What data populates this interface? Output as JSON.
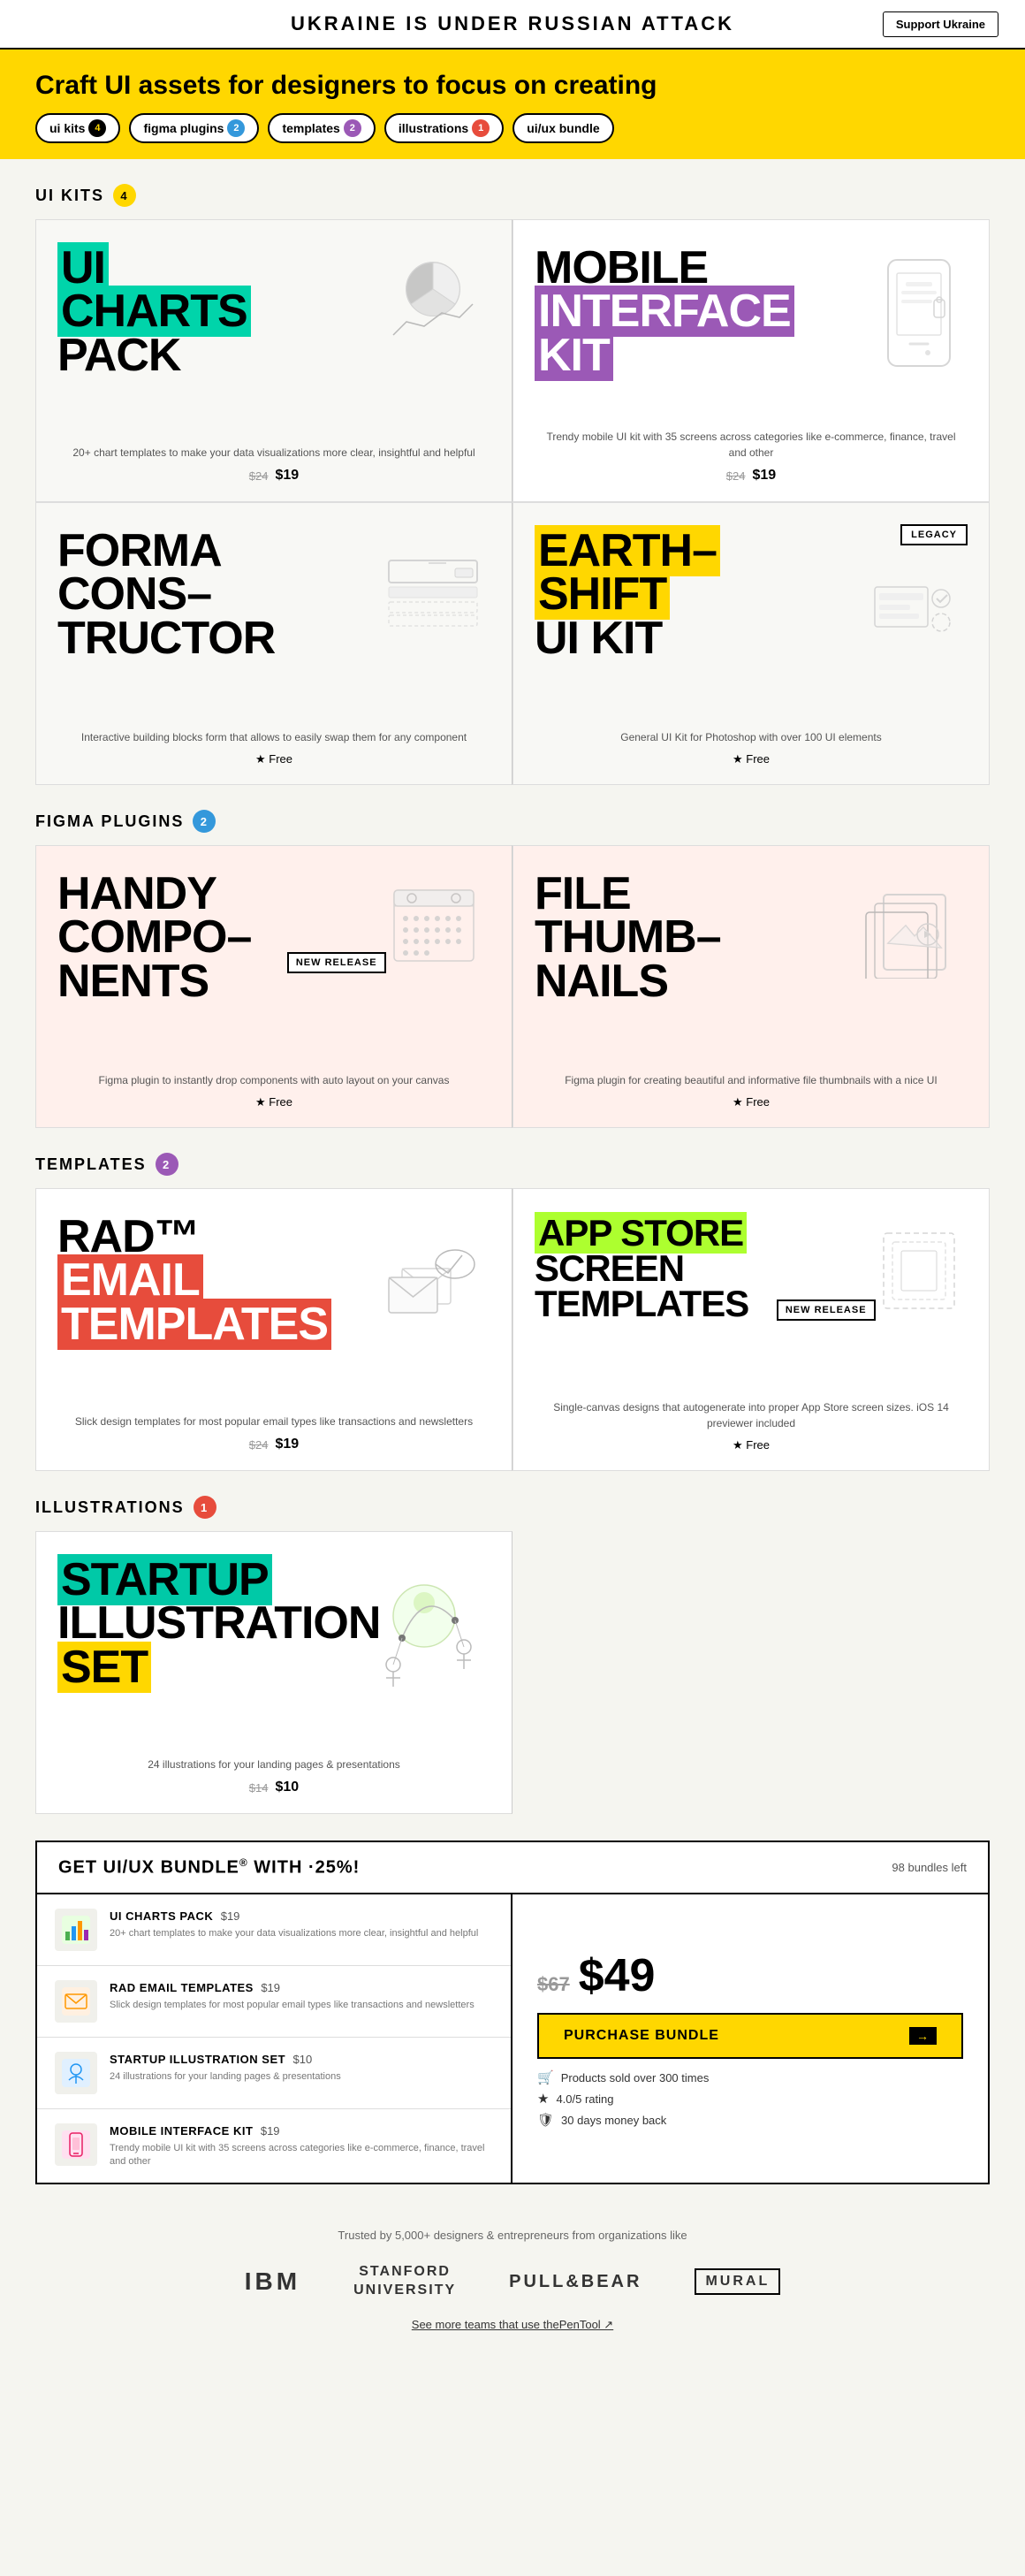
{
  "topBanner": {
    "title": "UKRAINE IS UNDER RUSSIAN ATTACK",
    "supportBtn": "Support Ukraine"
  },
  "hero": {
    "title": "Craft UI assets for designers to focus on creating",
    "filters": [
      {
        "id": "ui-kits",
        "label": "ui kits",
        "badge": "4",
        "badgeColor": "#FFD700",
        "textColor": "#000"
      },
      {
        "id": "figma-plugins",
        "label": "figma plugins",
        "badge": "2",
        "badgeColor": "#3498DB",
        "textColor": "#fff"
      },
      {
        "id": "templates",
        "label": "templates",
        "badge": "2",
        "badgeColor": "#9B59B6",
        "textColor": "#fff"
      },
      {
        "id": "illustrations",
        "label": "illustrations",
        "badge": "1",
        "badgeColor": "#E74C3C",
        "textColor": "#fff"
      },
      {
        "id": "bundle",
        "label": "ui/ux bundle",
        "badge": null
      }
    ]
  },
  "sections": {
    "uiKits": {
      "label": "UI KITS",
      "count": "4",
      "products": [
        {
          "id": "ui-charts-pack",
          "title1": "UI",
          "title2": "CHARTS",
          "title3": "PACK",
          "highlightColor": "green",
          "desc": "20+ chart templates to make your data visualizations more clear, insightful and helpful",
          "oldPrice": "$24",
          "newPrice": "$19",
          "free": false,
          "cardBg": "light"
        },
        {
          "id": "mobile-interface-kit",
          "title1": "MOBILE",
          "title2": "INTERFACE",
          "title3": "KIT",
          "highlightColor": "purple",
          "desc": "Trendy mobile UI kit with 35 screens across categories like e-commerce, finance, travel and other",
          "oldPrice": "$24",
          "newPrice": "$19",
          "free": false,
          "cardBg": "white"
        },
        {
          "id": "forma-constructor",
          "title1": "FORMA",
          "title2": "CONS–",
          "title3": "TRUCTOR",
          "highlightColor": "none",
          "desc": "Interactive building blocks form that allows to easily swap them for any component",
          "oldPrice": null,
          "newPrice": null,
          "free": true,
          "cardBg": "light"
        },
        {
          "id": "earth-shift-ui-kit",
          "title1": "EARTH–",
          "title2": "SHIFT",
          "title3": "UI KIT",
          "highlightColor": "yellow",
          "desc": "General UI Kit for Photoshop with over 100 UI elements",
          "oldPrice": null,
          "newPrice": null,
          "free": true,
          "legacy": true,
          "cardBg": "light"
        }
      ]
    },
    "figmaPlugins": {
      "label": "FIGMA PLUGINS",
      "count": "2",
      "products": [
        {
          "id": "handy-components",
          "title1": "HANDY",
          "title2": "COMPO–",
          "title3": "NENTS",
          "highlightColor": "none",
          "desc": "Figma plugin to instantly drop components with auto layout on your canvas",
          "free": true,
          "newRelease": true,
          "cardBg": "pink"
        },
        {
          "id": "file-thumbnails",
          "title1": "FILE",
          "title2": "THUMB–",
          "title3": "NAILS",
          "highlightColor": "none",
          "desc": "Figma plugin for creating beautiful and informative file thumbnails with a nice UI",
          "free": true,
          "cardBg": "pink"
        }
      ]
    },
    "templates": {
      "label": "TEMPLATES",
      "count": "2",
      "products": [
        {
          "id": "rad-email-templates",
          "title1": "RAD™",
          "title2": "EMAIL",
          "title3": "TEMPLATES",
          "highlightColor": "red",
          "desc": "Slick design templates for most popular email types like transactions and newsletters",
          "oldPrice": "$24",
          "newPrice": "$19",
          "free": false,
          "cardBg": "white"
        },
        {
          "id": "app-store-screen-templates",
          "title1": "APP STORE",
          "title2": "SCREEN",
          "title3": "TEMPLATES",
          "highlightColor": "lime",
          "desc": "Single-canvas designs that autogenerate into proper App Store screen sizes. iOS 14 previewer included",
          "free": true,
          "newRelease": true,
          "cardBg": "white"
        }
      ]
    },
    "illustrations": {
      "label": "ILLUSTRATIONS",
      "count": "1",
      "products": [
        {
          "id": "startup-illustration-set",
          "title1": "STARTUP",
          "title2": "ILLUSTRATION",
          "title3": "SET",
          "highlightColor": "teal",
          "desc": "24 illustrations for your landing pages & presentations",
          "oldPrice": "$14",
          "newPrice": "$10",
          "free": false,
          "cardBg": "white"
        }
      ]
    }
  },
  "bundle": {
    "header": "GET UI/UX BUNDLE",
    "discount": "·25%",
    "superscript": "®",
    "bundlesLeft": "98 bundles left",
    "items": [
      {
        "name": "UI CHARTS PACK",
        "price": "$19",
        "desc": "20+ chart templates to make your data visualizations more clear, insightful and helpful",
        "icon": "📊"
      },
      {
        "name": "RAD EMAIL TEMPLATES",
        "price": "$19",
        "desc": "Slick design templates for most popular email types like transactions and newsletters",
        "icon": "✉️"
      },
      {
        "name": "STARTUP ILLUSTRATION SET",
        "price": "$10",
        "desc": "24 illustrations for your landing pages & presentations",
        "icon": "🖊️"
      },
      {
        "name": "MOBILE INTERFACE KIT",
        "price": "$19",
        "desc": "Trendy mobile UI kit with 35 screens across categories like e-commerce, finance, travel and other",
        "icon": "📱"
      }
    ],
    "oldPrice": "$67",
    "newPrice": "$49",
    "purchaseBtn": "Purchase Bundle",
    "perks": [
      "Products sold over 300 times",
      "4.0/5 rating",
      "30 days money back"
    ]
  },
  "trusted": {
    "text": "Trusted by 5,000+ designers & entrepreneurs from organizations like",
    "logos": [
      "IBM",
      "Stanford\nUniversity",
      "PULL&BEAR",
      "MURAL"
    ],
    "seeMore": "See more teams that use thePenTool ↗"
  }
}
